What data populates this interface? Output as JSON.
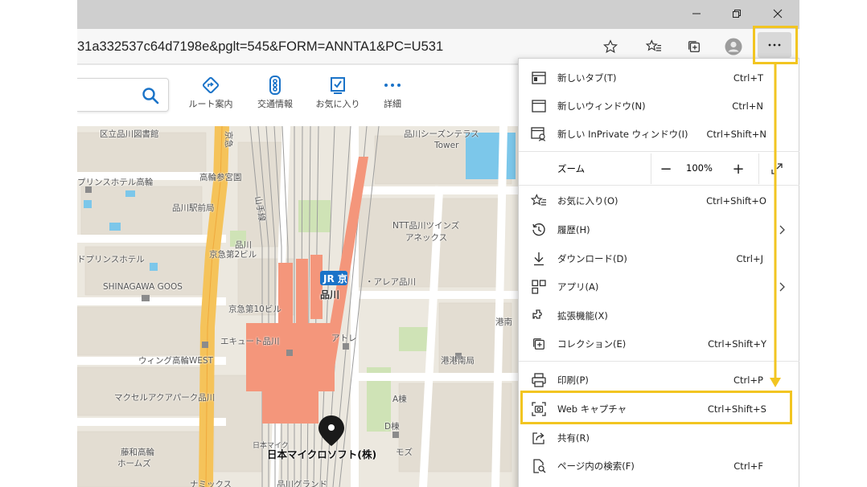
{
  "window": {
    "minimize_icon": "minimize-icon",
    "restore_icon": "restore-icon",
    "close_icon": "close-icon"
  },
  "address_bar": {
    "url": "31a332537c64d7198e&pglt=545&FORM=ANNTA1&PC=U531"
  },
  "map_toolbar": {
    "items": [
      {
        "label": "ルート案内",
        "icon": "route-icon"
      },
      {
        "label": "交通情報",
        "icon": "traffic-icon"
      },
      {
        "label": "お気に入り",
        "icon": "favorites-icon"
      },
      {
        "label": "詳細",
        "icon": "more-icon"
      }
    ]
  },
  "map": {
    "labels": {
      "l1": "区立品川図書館",
      "l2": "品川シーズンテラス",
      "l3": "Tower",
      "l4": "プリンスホテル高輪",
      "l5": "高輪参宮園",
      "l6": "品川駅前局",
      "l7": "山手線",
      "l8": "NTT品川ツインズ",
      "l9": "アネックス",
      "l10": "ドプリンスホテル",
      "l11": "京急第2ビル",
      "l12": "SHINAGAWA GOOS",
      "l13": "品川",
      "l14": "・アレア品川",
      "l15": "京急第10ビル",
      "l16": "港南",
      "l17": "アトレ",
      "l18": "エキュート品川",
      "l19": "港港南局",
      "l20": "ウィング高輪WEST",
      "l21": "マクセルアクアパーク品川",
      "l22": "A棟",
      "l23": "日本マイクロソフト(株)",
      "l24": "日本マイク",
      "l25": "ホームズ",
      "l26": "藤和高輪",
      "l27": "ナミックス",
      "l28": "品川グランド",
      "l29": "D棟",
      "l30": "モズ",
      "l31": "品川",
      "l32": "京急"
    }
  },
  "menu": {
    "items": [
      {
        "label": "新しいタブ(T)",
        "shortcut": "Ctrl+T",
        "icon": "new-tab-icon"
      },
      {
        "label": "新しいウィンドウ(N)",
        "shortcut": "Ctrl+N",
        "icon": "new-window-icon"
      },
      {
        "label": "新しい InPrivate ウィンドウ(I)",
        "shortcut": "Ctrl+Shift+N",
        "icon": "inprivate-icon"
      },
      {
        "label": "お気に入り(O)",
        "shortcut": "Ctrl+Shift+O",
        "icon": "favorites-icon"
      },
      {
        "label": "履歴(H)",
        "shortcut": "",
        "icon": "history-icon"
      },
      {
        "label": "ダウンロード(D)",
        "shortcut": "Ctrl+J",
        "icon": "download-icon"
      },
      {
        "label": "アプリ(A)",
        "shortcut": "",
        "icon": "apps-icon"
      },
      {
        "label": "拡張機能(X)",
        "shortcut": "",
        "icon": "extensions-icon"
      },
      {
        "label": "コレクション(E)",
        "shortcut": "Ctrl+Shift+Y",
        "icon": "collections-icon"
      },
      {
        "label": "印刷(P)",
        "shortcut": "Ctrl+P",
        "icon": "print-icon"
      },
      {
        "label": "Web キャプチャ",
        "shortcut": "Ctrl+Shift+S",
        "icon": "web-capture-icon"
      },
      {
        "label": "共有(R)",
        "shortcut": "",
        "icon": "share-icon"
      },
      {
        "label": "ページ内の検索(F)",
        "shortcut": "Ctrl+F",
        "icon": "find-icon"
      }
    ],
    "zoom": {
      "label": "ズーム",
      "minus": "−",
      "value": "100%",
      "plus": "+"
    }
  },
  "colors": {
    "highlight": "#f2c521",
    "map_background": "#ece8df",
    "rail_orange": "#f4967b",
    "road_yellow": "#f5c35a",
    "accent_blue": "#1a73c8"
  }
}
